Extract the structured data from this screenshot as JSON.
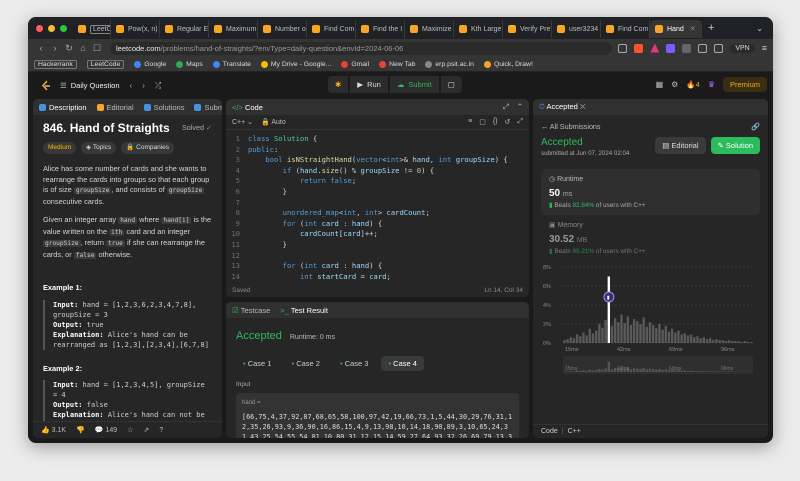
{
  "browser": {
    "tabs": [
      {
        "label": "LeetCode",
        "color": "#f5a623",
        "active": false,
        "boxed": true
      },
      {
        "label": "Pow(x, n)",
        "color": "#f5a623",
        "active": false
      },
      {
        "label": "Regular E",
        "color": "#f5a623",
        "active": false
      },
      {
        "label": "Maximum",
        "color": "#f5a623",
        "active": false
      },
      {
        "label": "Number o",
        "color": "#f5a623",
        "active": false
      },
      {
        "label": "Find Com",
        "color": "#f5a623",
        "active": false
      },
      {
        "label": "Find the I",
        "color": "#f5a623",
        "active": false
      },
      {
        "label": "Maximize",
        "color": "#f5a623",
        "active": false
      },
      {
        "label": "Kth Large",
        "color": "#f5a623",
        "active": false
      },
      {
        "label": "Verify Pre",
        "color": "#f5a623",
        "active": false
      },
      {
        "label": "user3234",
        "color": "#f5a623",
        "active": false
      },
      {
        "label": "Find Com",
        "color": "#f5a623",
        "active": false
      },
      {
        "label": "Hand",
        "color": "#f5a623",
        "active": true
      }
    ],
    "url_host": "leetcode.com",
    "url_path": "/problems/hand-of-straights/?envType=daily-question&envId=2024-06-06",
    "vpn_label": "VPN",
    "bookmarks": [
      {
        "label": "Hackerrank",
        "boxed": true
      },
      {
        "label": "LeetCode",
        "boxed": true
      },
      {
        "label": "Google",
        "color": "#4285f4"
      },
      {
        "label": "Maps",
        "color": "#34a853"
      },
      {
        "label": "Translate",
        "color": "#4285f4"
      },
      {
        "label": "My Drive - Google...",
        "color": "#fbbc05"
      },
      {
        "label": "Gmail",
        "color": "#ea4335"
      },
      {
        "label": "New Tab",
        "color": "#ea4335"
      },
      {
        "label": "erp.psit.ac.in",
        "color": "#888888"
      },
      {
        "label": "Quick, Draw!",
        "color": "#f5a623"
      }
    ]
  },
  "nav": {
    "daily_question": "Daily Question",
    "run": "Run",
    "submit": "Submit",
    "fire_count": "4",
    "premium": "Premium"
  },
  "left_panel": {
    "tabs": [
      "Description",
      "Editorial",
      "Solutions",
      "Subm"
    ],
    "title": "846. Hand of Straights",
    "solved": "Solved",
    "difficulty": "Medium",
    "topics": "Topics",
    "companies": "Companies",
    "p1_a": "Alice has some number of cards and she wants to rearrange the cards into groups so that each group is of size ",
    "p1_code1": "groupSize",
    "p1_b": ", and consists of ",
    "p1_code2": "groupSize",
    "p1_c": " consecutive cards.",
    "p2_a": "Given an integer array ",
    "p2_code1": "hand",
    "p2_b": " where ",
    "p2_code2": "hand[i]",
    "p2_c": " is the value written on the ",
    "p2_sup": "ith",
    "p2_d": " card and an integer ",
    "p2_code3": "groupSize",
    "p2_e": ", return ",
    "p2_code4": "true",
    "p2_f": " if she can rearrange the cards, or ",
    "p2_code5": "false",
    "p2_g": " otherwise.",
    "ex1_title": "Example 1:",
    "ex1_input_label": "Input:",
    "ex1_input": " hand = [1,2,3,6,2,3,4,7,8], groupSize = 3",
    "ex1_output_label": "Output:",
    "ex1_output": " true",
    "ex1_expl_label": "Explanation:",
    "ex1_expl": " Alice's hand can be rearranged as [1,2,3],[2,3,4],[6,7,8]",
    "ex2_title": "Example 2:",
    "ex2_input_label": "Input:",
    "ex2_input": " hand = [1,2,3,4,5], groupSize = 4",
    "ex2_output_label": "Output:",
    "ex2_output": " false",
    "ex2_expl_label": "Explanation:",
    "ex2_expl": " Alice's hand can not be rearranged into groups of 4.",
    "likes": "3.1K",
    "comments": "149"
  },
  "editor": {
    "title": "Code",
    "language": "C++",
    "auto": "Auto",
    "saved": "Saved",
    "position": "Ln 14, Col 34",
    "lines": [
      "class Solution {",
      "public:",
      "    bool isNStraightHand(vector<int>& hand, int groupSize) {",
      "        if (hand.size() % groupSize != 0) {",
      "            return false;",
      "        }",
      "",
      "        unordered_map<int, int> cardCount;",
      "        for (int card : hand) {",
      "            cardCount[card]++;",
      "        }",
      "",
      "        for (int card : hand) {",
      "            int startCard = card;"
    ]
  },
  "testresult": {
    "tab1": "Testcase",
    "tab2": "Test Result",
    "status": "Accepted",
    "runtime": "Runtime: 0 ms",
    "cases": [
      "Case 1",
      "Case 2",
      "Case 3",
      "Case 4"
    ],
    "input_label": "Input",
    "var_name": "hand =",
    "value": "[66,75,4,37,92,87,68,65,58,100,97,42,19,66,73,1,5,44,30,29,76,31,12,35,26,93,9,36,90,16,86,15,4,9,13,98,10,14,18,90,89,3,10,65,24,31,43,25,54,55,54,81,10,80,31,12,15,14,59,27,64,93,32,26,69,79,13,32,29,24,27,91,92,82,37,100,61,74,30,91,62,36,92,28,23,4,63,"
  },
  "accepted": {
    "tab": "Accepted",
    "all_submissions": "All Submissions",
    "status": "Accepted",
    "submitted": "submitted at Jun 07, 2024 02:04",
    "editorial": "Editorial",
    "solution": "Solution",
    "runtime_label": "Runtime",
    "runtime_value": "50",
    "runtime_unit": "ms",
    "runtime_beats_a": "Beats ",
    "runtime_beats_pct": "82.84%",
    "runtime_beats_b": " of users with C++",
    "memory_label": "Memory",
    "memory_value": "30.52",
    "memory_unit": "MB",
    "memory_beats_a": "Beats ",
    "memory_beats_pct": "69.21%",
    "memory_beats_b": " of users with C++",
    "code_label": "Code",
    "code_lang": "C++",
    "code_snippet": "class Solution {"
  },
  "chart_data": {
    "type": "bar",
    "y_ticks": [
      "8%",
      "6%",
      "4%",
      "2%",
      "0%"
    ],
    "x_ticks": [
      "15ms",
      "42ms",
      "69ms",
      "96ms"
    ],
    "ylim": [
      0,
      8
    ],
    "highlight_x": "50ms",
    "values": [
      0.3,
      0.4,
      0.6,
      0.5,
      0.9,
      0.7,
      1.1,
      0.8,
      1.5,
      1.0,
      1.3,
      2.0,
      1.6,
      2.4,
      7.0,
      1.8,
      2.6,
      2.2,
      3.0,
      2.1,
      2.8,
      1.9,
      2.5,
      2.3,
      2.0,
      2.7,
      1.7,
      2.2,
      1.9,
      1.6,
      2.0,
      1.4,
      1.8,
      1.2,
      1.5,
      1.1,
      1.3,
      0.9,
      1.0,
      0.8,
      0.9,
      0.6,
      0.7,
      0.5,
      0.6,
      0.4,
      0.5,
      0.3,
      0.4,
      0.3,
      0.3,
      0.2,
      0.3,
      0.2,
      0.2,
      0.2,
      0.1,
      0.2,
      0.1,
      0.1
    ]
  }
}
